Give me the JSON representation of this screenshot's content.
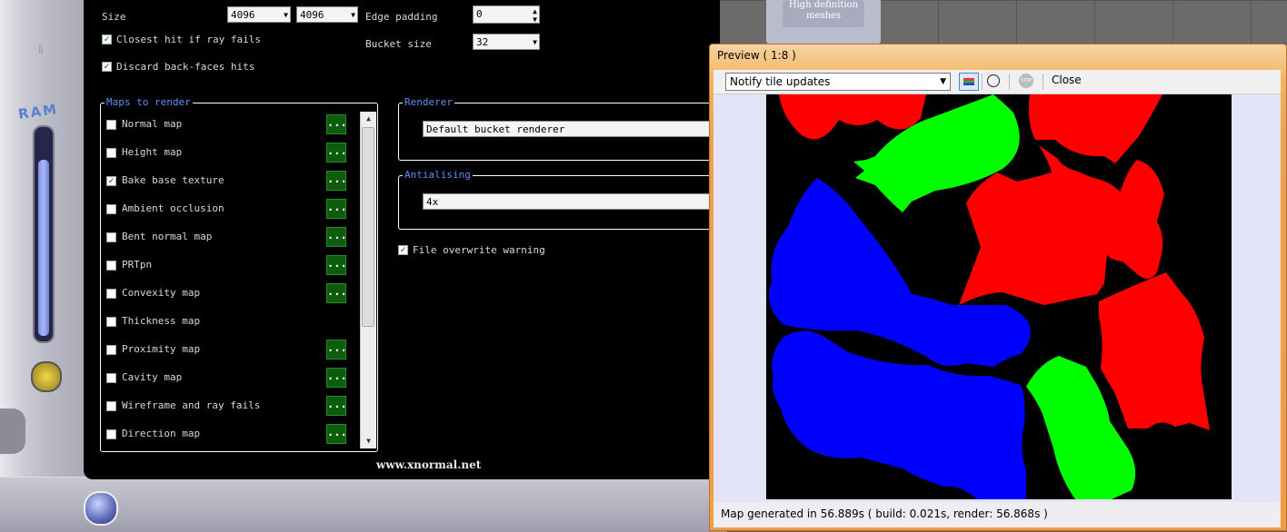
{
  "settings": {
    "size_label": "Size",
    "size_w": "4096",
    "size_h": "4096",
    "edge_padding_label": "Edge padding",
    "edge_padding_value": "0",
    "bucket_size_label": "Bucket size",
    "bucket_size_value": "32",
    "closest_hit_label": "Closest hit if ray fails",
    "discard_backfaces_label": "Discard back-faces hits"
  },
  "maps": {
    "title": "Maps to render",
    "items": [
      {
        "label": "Normal map",
        "checked": false,
        "has_options": true
      },
      {
        "label": "Height map",
        "checked": false,
        "has_options": true
      },
      {
        "label": "Bake base texture",
        "checked": true,
        "has_options": true
      },
      {
        "label": "Ambient occlusion",
        "checked": false,
        "has_options": true
      },
      {
        "label": "Bent normal map",
        "checked": false,
        "has_options": true
      },
      {
        "label": "PRTpn",
        "checked": false,
        "has_options": true
      },
      {
        "label": "Convexity map",
        "checked": false,
        "has_options": true
      },
      {
        "label": "Thickness map",
        "checked": false,
        "has_options": false
      },
      {
        "label": "Proximity map",
        "checked": false,
        "has_options": true
      },
      {
        "label": "Cavity map",
        "checked": false,
        "has_options": true
      },
      {
        "label": "Wireframe and ray fails",
        "checked": false,
        "has_options": true
      },
      {
        "label": "Direction map",
        "checked": false,
        "has_options": true
      }
    ],
    "options_label": "..."
  },
  "renderer": {
    "title": "Renderer",
    "value": "Default bucket renderer"
  },
  "antialiasing": {
    "title": "Antialising",
    "value": "4x"
  },
  "file_overwrite_label": "File overwrite warning",
  "website": "www.xnormal.net",
  "sidebar": {
    "ram_label": "RAM",
    "ram_level": 0.82
  },
  "hd_tab": {
    "label": "High definition meshes"
  },
  "preview": {
    "title": "Preview ( 1:8 )",
    "notify_value": "Notify tile updates",
    "close_label": "Close",
    "stop_label": "STOP",
    "status": "Map generated in 56.889s ( build: 0.021s, render: 56.868s )"
  },
  "colors": {
    "accent_blue": "#5c8ff0",
    "options_green": "#0c5c0c",
    "red": "#ff0000",
    "green": "#00ff00",
    "blue": "#0000ff"
  }
}
